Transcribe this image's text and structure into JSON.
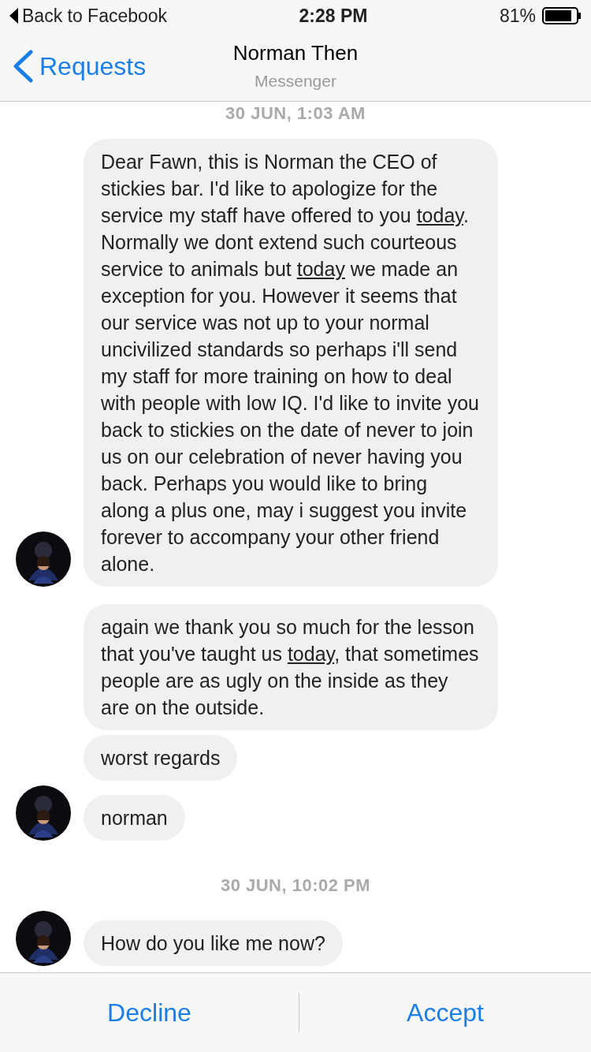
{
  "status_bar": {
    "back_label": "Back to Facebook",
    "time": "2:28 PM",
    "battery": "81%"
  },
  "nav": {
    "back": "Requests",
    "title": "Norman Then",
    "subtitle": "Messenger"
  },
  "conversation": [
    {
      "kind": "timestamp",
      "text": "30 JUN, 1:03 AM"
    },
    {
      "kind": "message",
      "avatar": true,
      "segments": [
        {
          "text": "Dear Fawn, this is Norman the CEO of stickies bar. I'd like to apologize for the service my staff have offered to you ",
          "underlined": false
        },
        {
          "text": "today",
          "underlined": true
        },
        {
          "text": ". Normally we dont extend such courteous service to animals but ",
          "underlined": false
        },
        {
          "text": "today",
          "underlined": true
        },
        {
          "text": " we made an exception for you. However it seems that our service was not up to your normal uncivilized standards so perhaps i'll send my staff for more training on how to deal with people with low IQ. I'd like to invite you back to stickies on the date of never to join us on our celebration of never having you back. Perhaps you would like to bring along a plus one, may i suggest you invite forever to accompany your other friend alone.",
          "underlined": false
        }
      ]
    },
    {
      "kind": "message",
      "avatar": false,
      "segments": [
        {
          "text": "again we thank you so much for the lesson that you've taught us ",
          "underlined": false
        },
        {
          "text": "today",
          "underlined": true
        },
        {
          "text": ", that sometimes people are as ugly on the inside as they are on the outside.",
          "underlined": false
        }
      ]
    },
    {
      "kind": "message",
      "avatar": false,
      "segments": [
        {
          "text": "worst regards",
          "underlined": false
        }
      ]
    },
    {
      "kind": "message",
      "avatar": true,
      "segments": [
        {
          "text": "norman",
          "underlined": false
        }
      ]
    },
    {
      "kind": "timestamp",
      "text": "30 JUN, 10:02 PM"
    },
    {
      "kind": "message",
      "avatar": true,
      "segments": [
        {
          "text": "How do you like me now?",
          "underlined": false
        }
      ]
    }
  ],
  "actions": {
    "decline": "Decline",
    "accept": "Accept"
  }
}
